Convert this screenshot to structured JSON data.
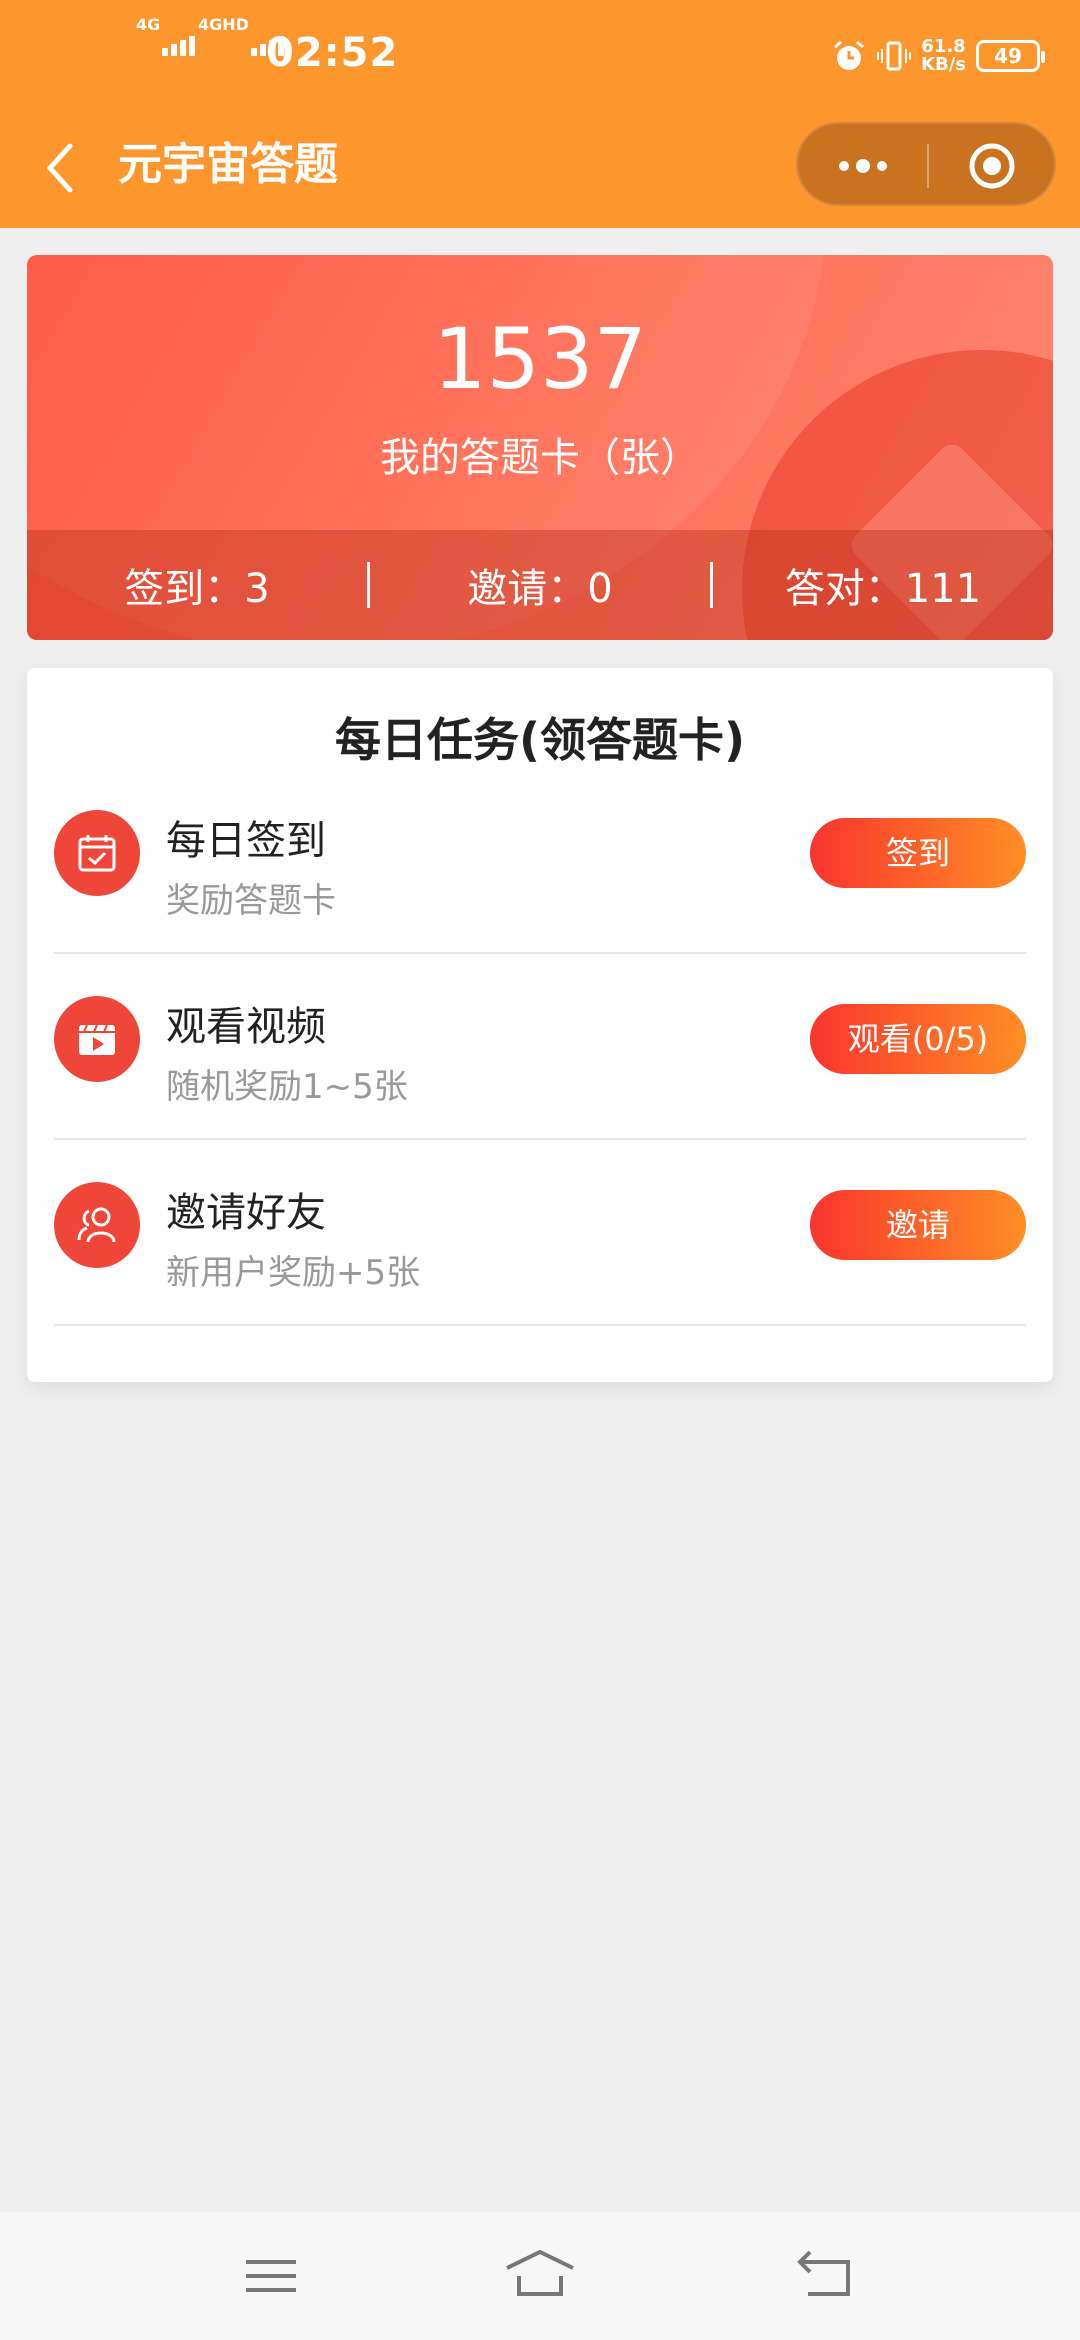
{
  "status_bar": {
    "network1": "4G",
    "network2": "4GHD",
    "time": "02:52",
    "speed_value": "61.8",
    "speed_unit": "KB/s",
    "battery": "49"
  },
  "app_bar": {
    "title": "元宇宙答题"
  },
  "summary": {
    "count": "1537",
    "count_label": "我的答题卡（张）",
    "stats": [
      {
        "label": "签到：3"
      },
      {
        "label": "邀请：0"
      },
      {
        "label": "答对：111"
      }
    ]
  },
  "tasks": {
    "title": "每日任务(领答题卡)",
    "items": [
      {
        "name": "每日签到",
        "desc": "奖励答题卡",
        "button": "签到",
        "icon": "calendar-check-icon"
      },
      {
        "name": "观看视频",
        "desc": "随机奖励1~5张",
        "button": "观看(0/5)",
        "icon": "video-play-icon"
      },
      {
        "name": "邀请好友",
        "desc": "新用户奖励+5张",
        "button": "邀请",
        "icon": "users-icon"
      }
    ]
  },
  "colors": {
    "app_bar": "#fe962e",
    "accent_red": "#f04539",
    "button_gradient_start": "#f9352e",
    "button_gradient_end": "#ff8f25"
  }
}
